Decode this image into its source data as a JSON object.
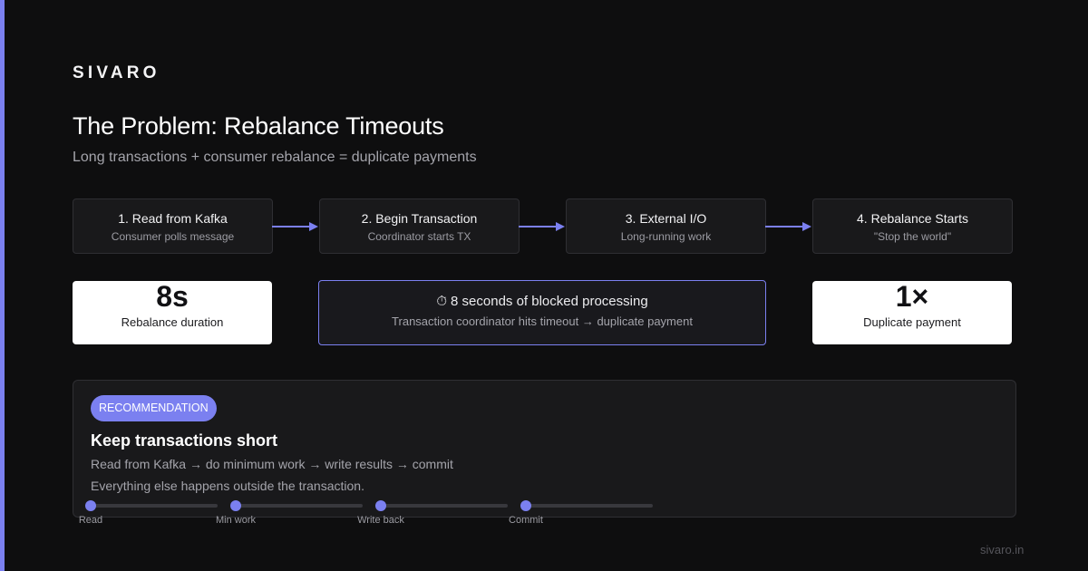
{
  "brand": "SIVARO",
  "title": "The Problem: Rebalance Timeouts",
  "subtitle": "Long transactions + consumer rebalance = duplicate payments",
  "accent_color": "#7b80f0",
  "steps": [
    {
      "title": "1. Read from Kafka",
      "desc": "Consumer polls message"
    },
    {
      "title": "2. Begin Transaction",
      "desc": "Coordinator starts TX"
    },
    {
      "title": "3. External I/O",
      "desc": "Long-running work"
    },
    {
      "title": "4. Rebalance Starts",
      "desc": "\"Stop the world\""
    }
  ],
  "stats": {
    "left": {
      "value": "8s",
      "label": "Rebalance duration"
    },
    "right": {
      "value": "1×",
      "label": "Duplicate payment"
    }
  },
  "blocked": {
    "icon": "stopwatch-icon",
    "icon_glyph": "⏱",
    "text": "8 seconds of blocked processing",
    "desc": "Transaction coordinator hits timeout → duplicate payment"
  },
  "recommendation": {
    "badge": "RECOMMENDATION",
    "title": "Keep transactions short",
    "line1": "Read from Kafka → do minimum work → write results → commit",
    "line2": "Everything else happens outside the transaction."
  },
  "timeline": [
    "Read",
    "Min work",
    "Write back",
    "Commit"
  ],
  "footer": "sivaro.in"
}
